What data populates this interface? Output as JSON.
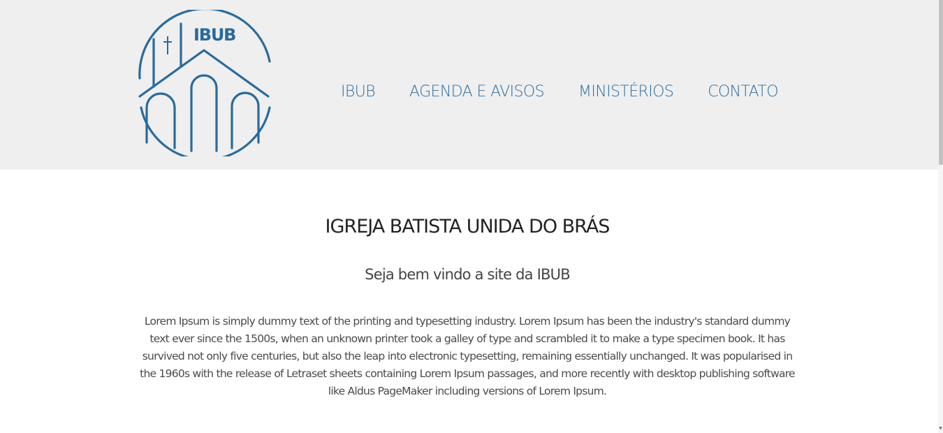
{
  "logo": {
    "text": "IBUB",
    "icon": "church-logo-icon",
    "color": "#2a6a9b"
  },
  "nav": {
    "items": [
      {
        "label": "IBUB"
      },
      {
        "label": "AGENDA E AVISOS"
      },
      {
        "label": "MINISTÉRIOS"
      },
      {
        "label": "CONTATO"
      }
    ],
    "color": "#2e6e9e"
  },
  "main": {
    "title": "IGREJA BATISTA UNIDA DO BRÁS",
    "subtitle": "Seja bem vindo a site da IBUB",
    "body": "Lorem Ipsum is simply dummy text of the printing and typesetting industry. Lorem Ipsum has been the industry's standard dummy text ever since the 1500s, when an unknown printer took a galley of type and scrambled it to make a type specimen book. It has survived not only five centuries, but also the leap into electronic typesetting, remaining essentially unchanged. It was popularised in the 1960s with the release of Letraset sheets containing Lorem Ipsum passages, and more recently with desktop publishing software like Aldus PageMaker including versions of Lorem Ipsum."
  },
  "colors": {
    "header_bg": "#efefef",
    "accent": "#2e6e9e"
  }
}
